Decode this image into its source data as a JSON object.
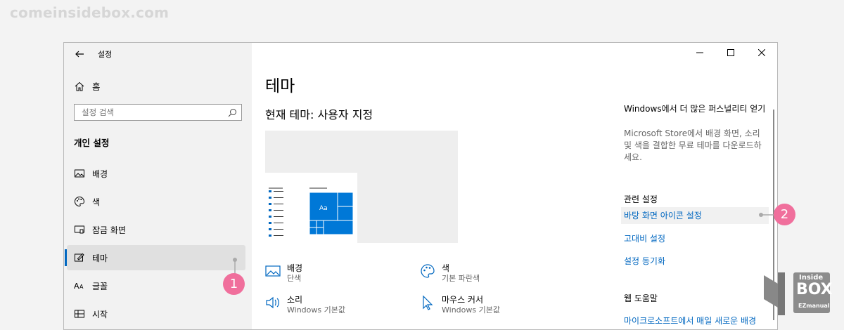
{
  "watermark": "comeinsidebox.com",
  "window": {
    "title": "설정"
  },
  "sidebar": {
    "home_label": "홈",
    "search_placeholder": "설정 검색",
    "section_title": "개인 설정",
    "items": [
      {
        "label": "배경",
        "icon": "image-icon"
      },
      {
        "label": "색",
        "icon": "palette-icon"
      },
      {
        "label": "잠금 화면",
        "icon": "lock-screen-icon"
      },
      {
        "label": "테마",
        "icon": "theme-icon",
        "active": true
      },
      {
        "label": "글꼴",
        "icon": "font-icon"
      },
      {
        "label": "시작",
        "icon": "start-icon"
      }
    ]
  },
  "main": {
    "title": "테마",
    "current_theme": "현재 테마: 사용자 지정",
    "preview_tile_text": "Aa",
    "settings": [
      {
        "label": "배경",
        "value": "단색",
        "icon": "image-icon"
      },
      {
        "label": "색",
        "value": "기본 파란색",
        "icon": "palette-icon"
      },
      {
        "label": "소리",
        "value": "Windows 기본값",
        "icon": "speaker-icon"
      },
      {
        "label": "마우스 커서",
        "value": "Windows 기본값",
        "icon": "cursor-icon"
      }
    ]
  },
  "right_panel": {
    "promo_title": "Windows에서 더 많은 퍼스널리티 얻기",
    "promo_text": "Microsoft Store에서 배경 화면, 소리 및 색을 결합한 무료 테마를 다운로드하세요.",
    "related_title": "관련 설정",
    "related_links": [
      "바탕 화면 아이콘 설정",
      "고대비 설정",
      "설정 동기화"
    ],
    "help_title": "웹 도움말",
    "help_link": "마이크로소프트에서 매일 새로운 배경"
  },
  "callouts": [
    "1",
    "2"
  ],
  "logo": {
    "line1": "Inside",
    "line2": "BOX",
    "line3": "EZmanual"
  },
  "colors": {
    "accent": "#0067c0",
    "callout": "#f06f9c"
  }
}
